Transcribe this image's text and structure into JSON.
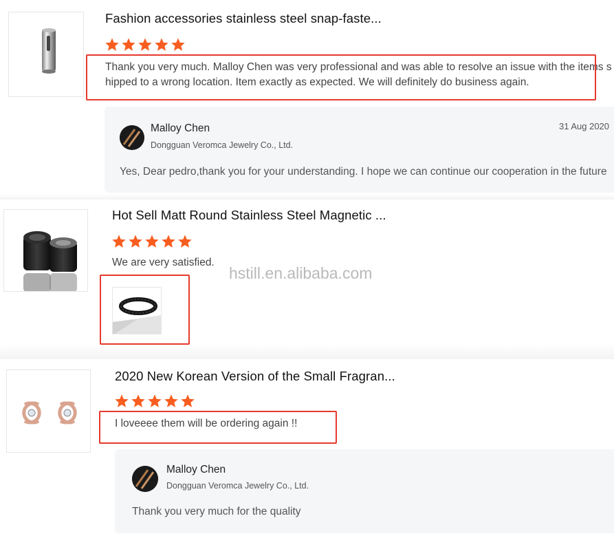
{
  "reviews": [
    {
      "product_title": "Fashion accessories stainless steel snap-faste...",
      "rating": 5,
      "review_line1": "Thank you very much. Malloy Chen was very professional and was able to resolve an issue with the items s",
      "review_line2": "hipped to a wrong location. Item exactly as expected. We will definitely do business again.",
      "reply": {
        "name": "Malloy Chen",
        "company": "Dongguan Veromca Jewelry Co., Ltd.",
        "date": "31 Aug 2020",
        "text": "Yes, Dear pedro,thank you for your understanding. I hope we can continue our cooperation in the future"
      }
    },
    {
      "product_title": "Hot Sell Matt Round Stainless Steel Magnetic ...",
      "rating": 5,
      "review": "We are very satisfied."
    },
    {
      "product_title": "2020 New Korean Version of the Small Fragran...",
      "rating": 5,
      "review": "I loveeee them will be ordering again !!",
      "reply": {
        "name": "Malloy Chen",
        "company": "Dongguan Veromca Jewelry Co., Ltd.",
        "text": "Thank you very much for the quality"
      }
    }
  ],
  "watermark": "hstill.en.alibaba.com",
  "colors": {
    "star": "#f85d1f",
    "highlight_box": "#e53a2c",
    "reply_bg": "#f5f6f8"
  }
}
